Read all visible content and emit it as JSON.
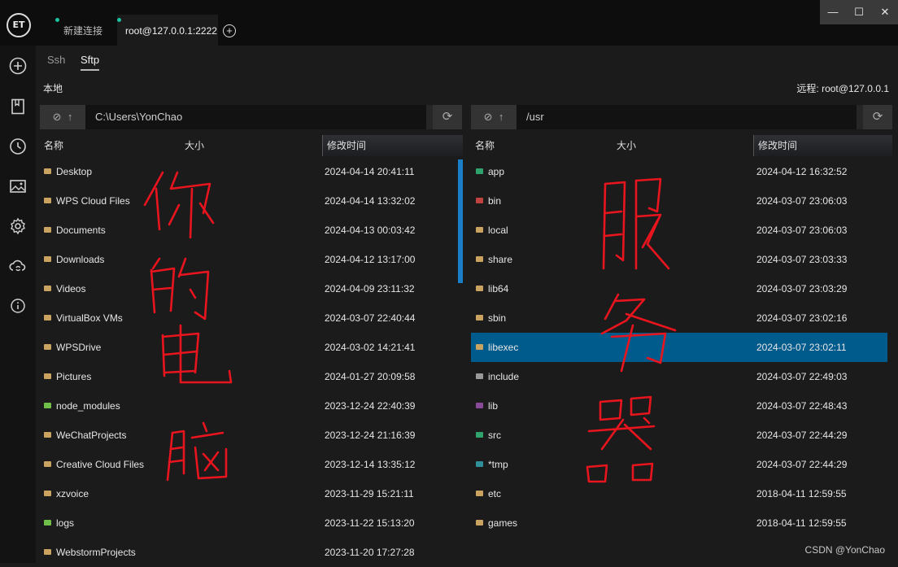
{
  "app": {
    "logo_text": "ET",
    "tabs": [
      {
        "label": "新建连接"
      },
      {
        "label": "root@127.0.0.1:2222"
      }
    ],
    "add_tab_glyph": "+",
    "window_controls": {
      "minimize": "—",
      "maximize": "☐",
      "close": "✕"
    }
  },
  "sidebar": {
    "items": [
      {
        "icon": "add-icon"
      },
      {
        "icon": "bookmark-icon"
      },
      {
        "icon": "clock-icon"
      },
      {
        "icon": "image-icon"
      },
      {
        "icon": "gear-icon"
      },
      {
        "icon": "cloud-sync-icon"
      },
      {
        "icon": "info-icon"
      }
    ]
  },
  "mode_tabs": [
    "Ssh",
    "Sftp"
  ],
  "local": {
    "label": "本地",
    "path": "C:\\Users\\YonChao",
    "columns": {
      "name": "名称",
      "size": "大小",
      "time": "修改时间"
    },
    "files": [
      {
        "name": "Desktop",
        "time": "2024-04-14 20:41:11"
      },
      {
        "name": "WPS Cloud Files",
        "time": "2024-04-14 13:32:02"
      },
      {
        "name": "Documents",
        "time": "2024-04-13 00:03:42"
      },
      {
        "name": "Downloads",
        "time": "2024-04-12 13:17:00"
      },
      {
        "name": "Videos",
        "time": "2024-04-09 23:11:32"
      },
      {
        "name": "VirtualBox VMs",
        "time": "2024-03-07 22:40:44"
      },
      {
        "name": "WPSDrive",
        "time": "2024-03-02 14:21:41"
      },
      {
        "name": "Pictures",
        "time": "2024-01-27 20:09:58"
      },
      {
        "name": "node_modules",
        "time": "2023-12-24 22:40:39"
      },
      {
        "name": "WeChatProjects",
        "time": "2023-12-24 21:16:39"
      },
      {
        "name": "Creative Cloud Files",
        "time": "2023-12-14 13:35:12"
      },
      {
        "name": "xzvoice",
        "time": "2023-11-29 15:21:11"
      },
      {
        "name": "logs",
        "time": "2023-11-22 15:13:20"
      },
      {
        "name": "WebstormProjects",
        "time": "2023-11-20 17:27:28"
      }
    ]
  },
  "remote": {
    "label": "远程: root@127.0.0.1",
    "path": "/usr",
    "columns": {
      "name": "名称",
      "size": "大小",
      "time": "修改时间"
    },
    "files": [
      {
        "name": "app",
        "time": "2024-04-12 16:32:52"
      },
      {
        "name": "bin",
        "time": "2024-03-07 23:06:03"
      },
      {
        "name": "local",
        "time": "2024-03-07 23:06:03"
      },
      {
        "name": "share",
        "time": "2024-03-07 23:03:33"
      },
      {
        "name": "lib64",
        "time": "2024-03-07 23:03:29"
      },
      {
        "name": "sbin",
        "time": "2024-03-07 23:02:16"
      },
      {
        "name": "libexec",
        "time": "2024-03-07 23:02:11",
        "selected": true
      },
      {
        "name": "include",
        "time": "2024-03-07 22:49:03"
      },
      {
        "name": "lib",
        "time": "2024-03-07 22:48:43"
      },
      {
        "name": "src",
        "time": "2024-03-07 22:44:29"
      },
      {
        "name": "*tmp",
        "time": "2024-03-07 22:44:29"
      },
      {
        "name": "etc",
        "time": "2018-04-11 12:59:55"
      },
      {
        "name": "games",
        "time": "2018-04-11 12:59:55"
      }
    ]
  },
  "annotations": {
    "left": [
      "你",
      "的",
      "电",
      "脑"
    ],
    "right": [
      "服",
      "务",
      "器"
    ],
    "color": "#e8141e"
  },
  "watermark": "CSDN @YonChao",
  "colors": {
    "selection": "#005b8d",
    "scrollbar": "#1a7fc8",
    "status_dot": "#19c2a0",
    "folder": "#c9a35f"
  }
}
